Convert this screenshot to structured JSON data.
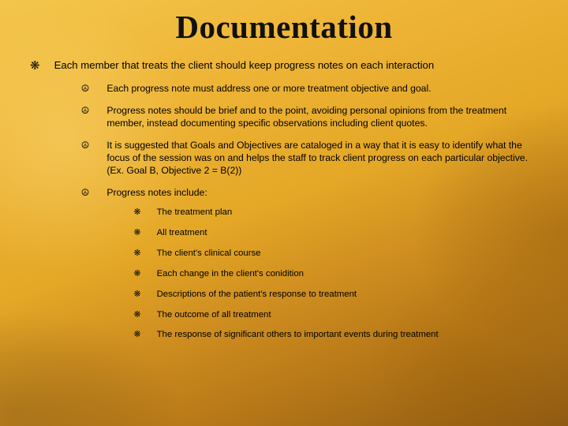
{
  "title": "Documentation",
  "bullet": {
    "lvl1": "❋",
    "lvl2": "☮",
    "lvl3": "❋"
  },
  "lvl1": [
    {
      "text": "Each member that treats the client should keep progress notes on each interaction",
      "lvl2": [
        {
          "text": "Each progress note must address one or more treatment objective and goal."
        },
        {
          "text": "Progress notes should be brief and to the point, avoiding personal opinions from the treatment member, instead documenting specific observations including client quotes."
        },
        {
          "text": "It is suggested that Goals and Objectives are cataloged in a way that it is easy to identify what the focus of the session was on and helps the staff to track client progress on each particular objective. (Ex. Goal B, Objective 2 = B(2))"
        },
        {
          "text": "Progress notes include:",
          "lvl3": [
            {
              "text": "The treatment plan"
            },
            {
              "text": "All treatment"
            },
            {
              "text": "The client's clinical course"
            },
            {
              "text": "Each change in the client's conidition"
            },
            {
              "text": "Descriptions of the patient's response to treatment"
            },
            {
              "text": "The outcome of all treatment"
            },
            {
              "text": "The response of significant others to important events during treatment"
            }
          ]
        }
      ]
    }
  ]
}
